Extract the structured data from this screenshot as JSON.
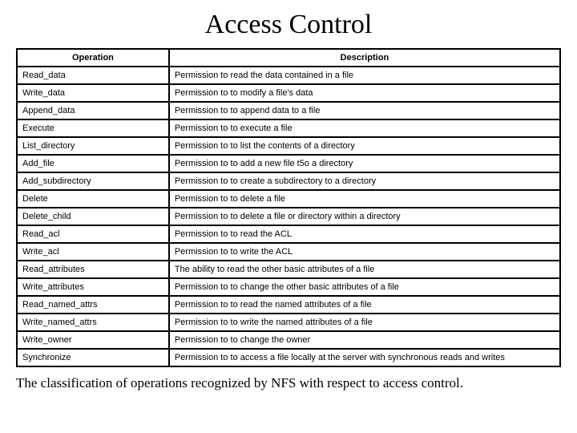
{
  "title": "Access Control",
  "headers": {
    "operation": "Operation",
    "description": "Description"
  },
  "rows": [
    {
      "op": "Read_data",
      "desc": "Permission to read the data contained in a file"
    },
    {
      "op": "Write_data",
      "desc": "Permission to to modify a file's data"
    },
    {
      "op": "Append_data",
      "desc": "Permission to to append data to a file"
    },
    {
      "op": "Execute",
      "desc": "Permission to to execute a file"
    },
    {
      "op": "List_directory",
      "desc": "Permission to to list the contents of a directory"
    },
    {
      "op": "Add_file",
      "desc": "Permission to to add a new file t5o a directory"
    },
    {
      "op": "Add_subdirectory",
      "desc": "Permission to to create a subdirectory to a directory"
    },
    {
      "op": "Delete",
      "desc": "Permission to to delete a file"
    },
    {
      "op": "Delete_child",
      "desc": "Permission to to delete a file or directory within a directory"
    },
    {
      "op": "Read_acl",
      "desc": "Permission to to read the ACL"
    },
    {
      "op": "Write_acl",
      "desc": "Permission to to write the ACL"
    },
    {
      "op": "Read_attributes",
      "desc": "The ability to read  the other basic attributes of a file"
    },
    {
      "op": "Write_attributes",
      "desc": "Permission to to change the other basic attributes of a file"
    },
    {
      "op": "Read_named_attrs",
      "desc": "Permission to to read the named attributes of a file"
    },
    {
      "op": "Write_named_attrs",
      "desc": "Permission to to write the named attributes of a file"
    },
    {
      "op": "Write_owner",
      "desc": "Permission to to change the owner"
    },
    {
      "op": "Synchronize",
      "desc": "Permission to to access a file locally at the server with synchronous reads and writes"
    }
  ],
  "caption": "The classification of operations recognized by NFS with respect to access control."
}
